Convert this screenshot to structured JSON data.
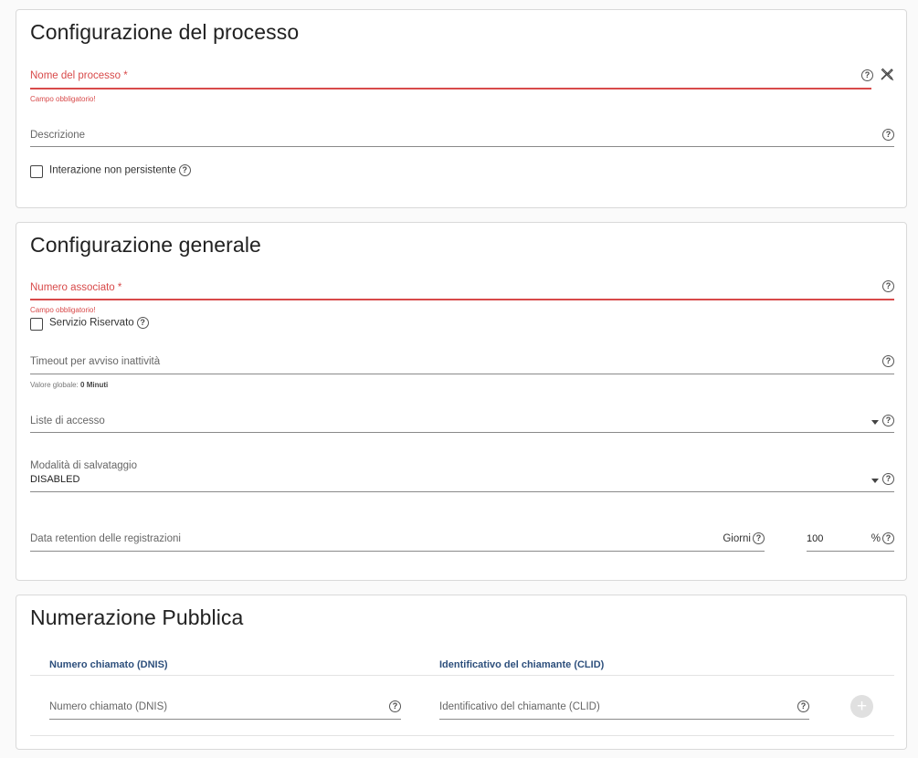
{
  "process_config": {
    "title": "Configurazione del processo",
    "process_name_label": "Nome del processo *",
    "process_name_error": "Campo obbligatorio!",
    "description_label": "Descrizione",
    "non_persistent_label": "Interazione non persistente"
  },
  "general_config": {
    "title": "Configurazione generale",
    "associated_number_label": "Numero associato *",
    "associated_number_error": "Campo obbligatorio!",
    "reserved_service_label": "Servizio Riservato",
    "timeout_label": "Timeout per avviso inattività",
    "timeout_hint_prefix": "Valore globale:",
    "timeout_hint_value": "0 Minuti",
    "access_lists_label": "Liste di accesso",
    "save_mode_label": "Modalità di salvataggio",
    "save_mode_value": "DISABLED",
    "retention_label": "Data retention delle registrazioni",
    "retention_unit": "Giorni",
    "percent_value": "100",
    "percent_unit": "%"
  },
  "public_numbering": {
    "title": "Numerazione Pubblica",
    "col_dnis": "Numero chiamato (DNIS)",
    "col_clid": "Identificativo del chiamante (CLID)",
    "dnis_placeholder": "Numero chiamato (DNIS)",
    "clid_placeholder": "Identificativo del chiamante (CLID)",
    "add_symbol": "+"
  },
  "icons": {
    "help": "?",
    "tools": "tools-icon",
    "dropdown": "caret-down-icon"
  },
  "colors": {
    "error": "#d84a4a",
    "column_header": "#2d4f7c"
  }
}
